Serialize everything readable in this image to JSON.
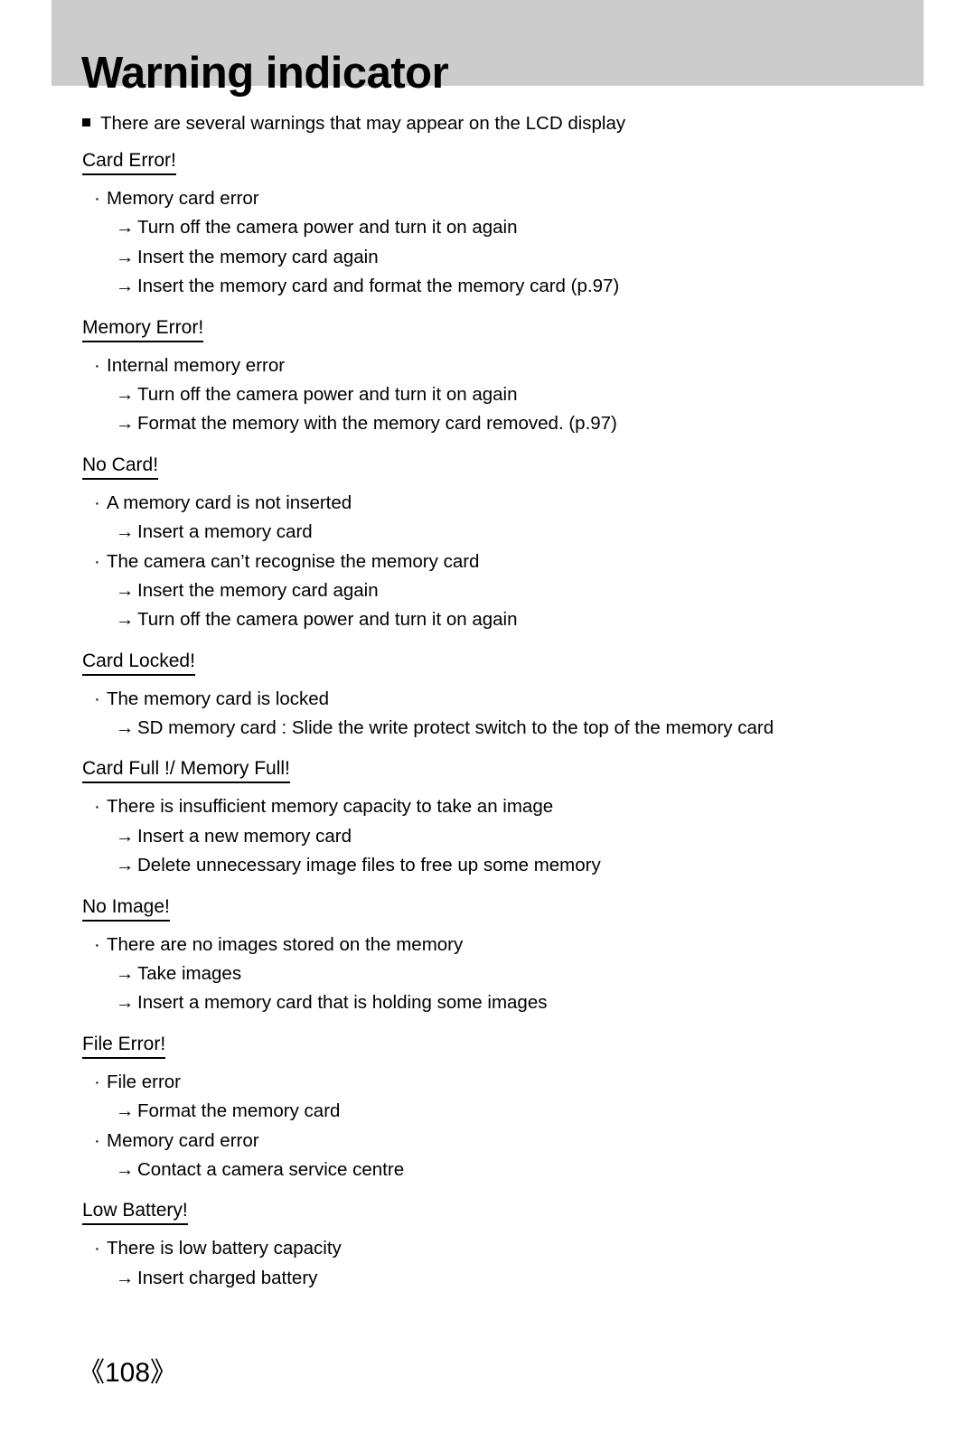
{
  "header": {
    "title": "Warning indicator",
    "band_color": "#cccccc"
  },
  "intro": {
    "bullet_icon": "filled-square-bullet",
    "text": "There are several warnings that may appear on the LCD display"
  },
  "markers": {
    "cause": "·",
    "action": "→"
  },
  "sections": [
    {
      "heading": "Card Error!",
      "items": [
        {
          "type": "cause",
          "text": "Memory card error"
        },
        {
          "type": "action",
          "text": "Turn off the camera power and turn it on again"
        },
        {
          "type": "action",
          "text": "Insert the memory card again"
        },
        {
          "type": "action",
          "text": "Insert the memory card and format the memory card (p.97)"
        }
      ]
    },
    {
      "heading": "Memory Error!",
      "items": [
        {
          "type": "cause",
          "text": "Internal memory error"
        },
        {
          "type": "action",
          "text": "Turn off the camera power and turn it on again"
        },
        {
          "type": "action",
          "text": "Format the memory with the memory card removed. (p.97)"
        }
      ]
    },
    {
      "heading": "No Card!",
      "items": [
        {
          "type": "cause",
          "text": "A memory card is not inserted"
        },
        {
          "type": "action",
          "text": "Insert a memory card"
        },
        {
          "type": "cause",
          "text": "The camera can’t recognise the memory card"
        },
        {
          "type": "action",
          "text": "Insert the memory card again"
        },
        {
          "type": "action",
          "text": "Turn off the camera power and turn it on again"
        }
      ]
    },
    {
      "heading": "Card Locked!",
      "items": [
        {
          "type": "cause",
          "text": "The memory card is locked"
        },
        {
          "type": "action",
          "text": "SD memory card : Slide the write protect switch to the top of the memory card"
        }
      ]
    },
    {
      "heading": "Card Full !/ Memory Full!",
      "items": [
        {
          "type": "cause",
          "text": "There is insufficient memory capacity to take an image"
        },
        {
          "type": "action",
          "text": "Insert a new memory card"
        },
        {
          "type": "action",
          "text": "Delete unnecessary image files to free up some memory"
        }
      ]
    },
    {
      "heading": "No Image!",
      "items": [
        {
          "type": "cause",
          "text": "There are no images stored on the memory"
        },
        {
          "type": "action",
          "text": "Take images"
        },
        {
          "type": "action",
          "text": "Insert a memory card that is holding some images"
        }
      ]
    },
    {
      "heading": "File Error!",
      "items": [
        {
          "type": "cause",
          "text": "File error"
        },
        {
          "type": "action",
          "text": "Format the memory card"
        },
        {
          "type": "cause",
          "text": "Memory card error"
        },
        {
          "type": "action",
          "text": "Contact a camera service centre"
        }
      ]
    },
    {
      "heading": "Low Battery!",
      "items": [
        {
          "type": "cause",
          "text": "There is low battery capacity"
        },
        {
          "type": "action",
          "text": "Insert charged battery"
        }
      ]
    }
  ],
  "footer": {
    "page_number": "《108》"
  }
}
